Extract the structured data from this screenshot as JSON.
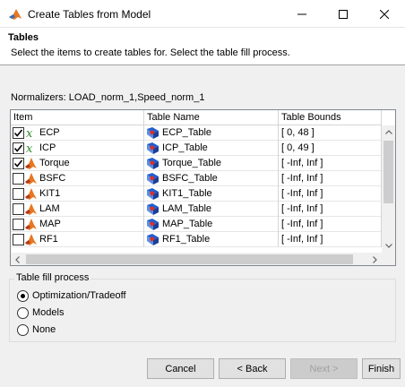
{
  "window": {
    "title": "Create Tables from Model",
    "controls": [
      "minimize-icon",
      "maximize-icon",
      "close-icon"
    ]
  },
  "header": {
    "title": "Tables",
    "subtitle": "Select the items to create tables for. Select the table fill process."
  },
  "normalizers_text": "Normalizers: LOAD_norm_1,Speed_norm_1",
  "table": {
    "columns": [
      "Item",
      "Table Name",
      "Table Bounds"
    ],
    "rows": [
      {
        "checked": true,
        "icon": "variable-x-icon",
        "item": "ECP",
        "table_name": "ECP_Table",
        "bounds": "[ 0, 48 ]"
      },
      {
        "checked": true,
        "icon": "variable-x-icon",
        "item": "ICP",
        "table_name": "ICP_Table",
        "bounds": "[ 0, 49 ]"
      },
      {
        "checked": true,
        "icon": "model-icon",
        "item": "Torque",
        "table_name": "Torque_Table",
        "bounds": "[ -Inf, Inf ]"
      },
      {
        "checked": false,
        "icon": "model-icon",
        "item": "BSFC",
        "table_name": "BSFC_Table",
        "bounds": "[ -Inf, Inf ]"
      },
      {
        "checked": false,
        "icon": "model-icon",
        "item": "KIT1",
        "table_name": "KIT1_Table",
        "bounds": "[ -Inf, Inf ]"
      },
      {
        "checked": false,
        "icon": "model-icon",
        "item": "LAM",
        "table_name": "LAM_Table",
        "bounds": "[ -Inf, Inf ]"
      },
      {
        "checked": false,
        "icon": "model-icon",
        "item": "MAP",
        "table_name": "MAP_Table",
        "bounds": "[ -Inf, Inf ]"
      },
      {
        "checked": false,
        "icon": "model-icon",
        "item": "RF1",
        "table_name": "RF1_Table",
        "bounds": "[ -Inf, Inf ]"
      }
    ]
  },
  "fill_process": {
    "legend": "Table fill process",
    "options": [
      {
        "label": "Optimization/Tradeoff",
        "selected": true
      },
      {
        "label": "Models",
        "selected": false
      },
      {
        "label": "None",
        "selected": false
      }
    ]
  },
  "buttons": {
    "cancel": "Cancel",
    "back": "< Back",
    "next": "Next >",
    "finish": "Finish",
    "next_enabled": false
  },
  "colors": {
    "accent": "#0078d7",
    "model_icon_orange": "#e87722",
    "table_icon_blue": "#1f5fd1",
    "variable_green": "#2a8a2a"
  }
}
